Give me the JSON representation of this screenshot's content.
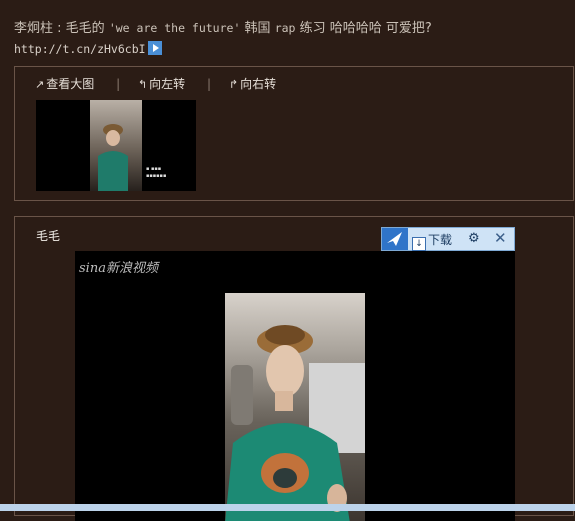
{
  "post": {
    "author": "李炯柱",
    "text_cn1": "毛毛的",
    "text_en": "'we are the future'",
    "text_cn2": "韩国",
    "text_rap": "rap",
    "text_cn3": "练习 哈哈哈哈 可爱把?",
    "link": "http://t.cn/zHv6cbI"
  },
  "toolbar": {
    "view_large": "查看大图",
    "rotate_left": "向左转",
    "rotate_right": "向右转"
  },
  "video": {
    "author_name": "毛毛",
    "brand": "sina新浪视频",
    "download_label": "下载"
  },
  "colors": {
    "background": "#2b1c15",
    "border": "#6a5448",
    "accent_blue": "#2f74c9"
  }
}
